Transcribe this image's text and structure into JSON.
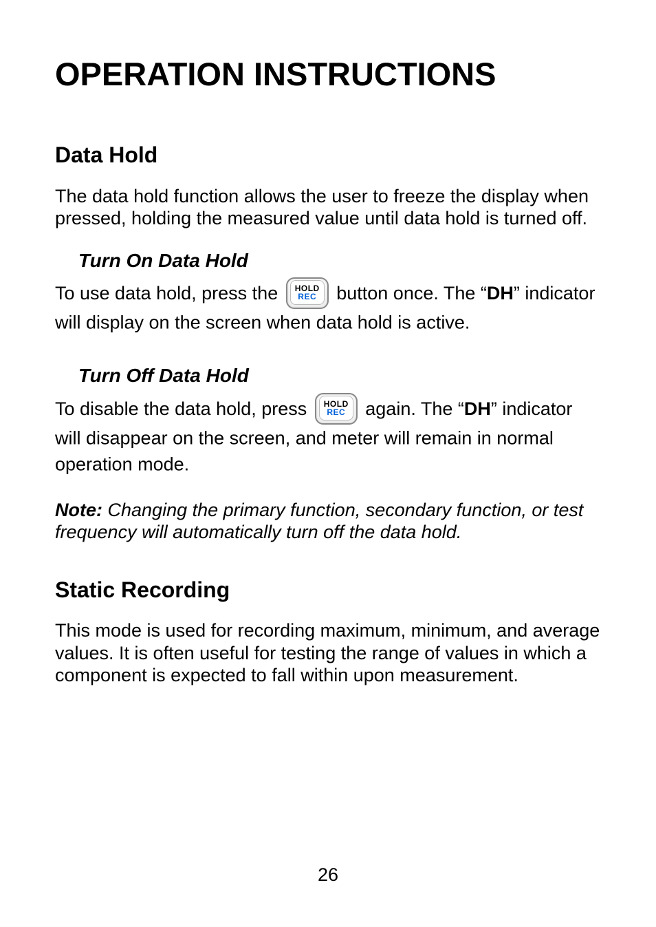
{
  "title": "OPERATION INSTRUCTIONS",
  "sections": {
    "datahold": {
      "heading": "Data Hold",
      "intro": "The data hold function allows the user to freeze the display when pressed, holding the measured value until data hold is turned off.",
      "turnOn": {
        "heading": "Turn On Data Hold",
        "pre": "To use data hold, press the ",
        "post1": " button once.  The “",
        "dh": "DH",
        "post2": "” indicator will display on the screen when data hold is active."
      },
      "turnOff": {
        "heading": "Turn Off Data Hold",
        "pre": "To disable the data hold, press ",
        "post1": " again.  The “",
        "dh": "DH",
        "post2": "” indicator will disappear on the screen, and meter will remain in normal operation mode."
      },
      "noteLead": "Note:",
      "noteBody": "  Changing the primary function, secondary function, or test frequency will automatically turn off the data hold."
    },
    "static": {
      "heading": "Static Recording",
      "body": "This mode is used for recording maximum, minimum, and average values.  It is often useful for testing the range of values in which a component is expected to fall within upon measurement."
    }
  },
  "button": {
    "line1": "HOLD",
    "line2": "REC"
  },
  "pageNumber": "26"
}
